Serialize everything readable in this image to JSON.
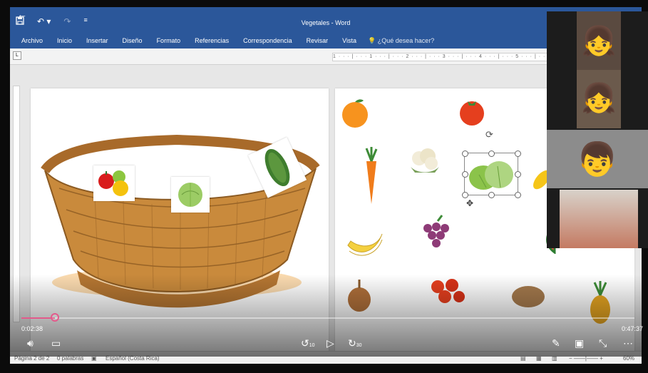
{
  "word": {
    "doc_title": "Vegetales - Word",
    "qat": {
      "save_icon": "save-icon",
      "undo_icon": "undo-icon",
      "redo_icon": "redo-icon",
      "customize_icon": "customize-icon"
    },
    "ribbon_tabs": [
      "Archivo",
      "Inicio",
      "Insertar",
      "Diseño",
      "Formato",
      "Referencias",
      "Correspondencia",
      "Revisar",
      "Vista"
    ],
    "tell_me": "¿Qué desea hacer?",
    "ruler_marks": "1 · · · | · · · 1 · · · | · · · 2 · · · | · · · 3 · · · | · · · 4 · · · | · · · 5 · · · | · · · 6 · · · | · · · 7 · · ·",
    "ruler_corner": "L",
    "status": {
      "page": "Página 2 de 2",
      "words": "0 palabras",
      "language": "Español (Costa Rica)",
      "zoom": "60%"
    }
  },
  "video": {
    "elapsed": "0:02:38",
    "duration": "0:47:37",
    "progress": 0.055,
    "accent": "#e35a8b",
    "skip_back": "10",
    "skip_forward": "30"
  },
  "colors": {
    "ribbon": "#2b579a"
  }
}
